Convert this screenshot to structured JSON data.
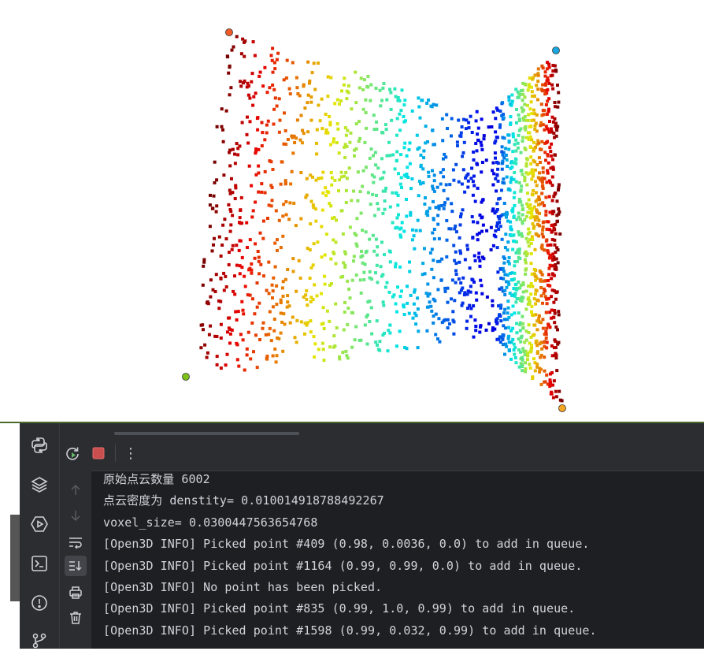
{
  "viewer": {
    "pointcloud_description": "colored point cloud (jet colormap) of two surfaces",
    "picked_markers": [
      {
        "color": "#f05a28"
      },
      {
        "color": "#1aa7e0"
      },
      {
        "color": "#7cc21b"
      },
      {
        "color": "#f5a623"
      }
    ]
  },
  "ide": {
    "activity_icons": [
      "python-packages-icon",
      "layers-icon",
      "run-services-icon",
      "terminal-icon",
      "problems-icon",
      "git-icon"
    ],
    "toolbar": {
      "rerun_icon": "rerun-icon",
      "stop_icon": "stop-icon",
      "more_icon": "more-icon",
      "more_label": "⋮"
    },
    "side_tools": [
      "up-arrow-icon",
      "down-arrow-icon",
      "soft-wrap-icon",
      "scroll-to-end-icon",
      "print-icon",
      "trash-icon"
    ],
    "console_lines": [
      "原始点云数量 6002",
      "点云密度为 denstity= 0.010014918788492267",
      "voxel_size= 0.0300447563654768",
      "[Open3D INFO] Picked point #409 (0.98, 0.0036, 0.0) to add in queue.",
      "[Open3D INFO] Picked point #1164 (0.99, 0.99, 0.0) to add in queue.",
      "[Open3D INFO] No point has been picked.",
      "[Open3D INFO] Picked point #835 (0.99, 1.0, 0.99) to add in queue.",
      "[Open3D INFO] Picked point #1598 (0.99, 0.032, 0.99) to add in queue."
    ]
  }
}
